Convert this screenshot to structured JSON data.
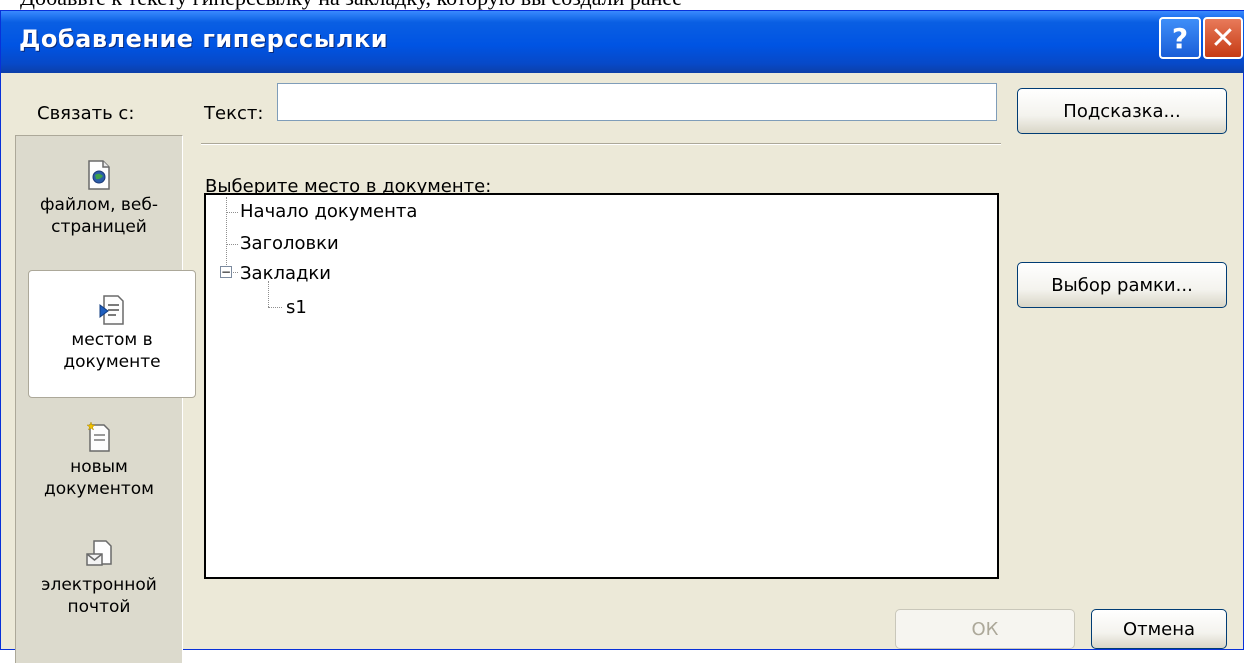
{
  "background_text": "Добавьте к тексту гиперссылку на закладку, которую вы создали ранее",
  "dialog": {
    "title": "Добавление гиперссылки",
    "help_button": "?",
    "close_button": "✕"
  },
  "sidebar": {
    "label": "Связать с:",
    "items": [
      {
        "label": "файлом, веб-\nстраницей",
        "icon": "web-page-icon",
        "selected": false
      },
      {
        "label": "местом в\nдокументе",
        "icon": "document-place-icon",
        "selected": true
      },
      {
        "label": "новым\nдокументом",
        "icon": "new-document-icon",
        "selected": false
      },
      {
        "label": "электронной\nпочтой",
        "icon": "email-icon",
        "selected": false
      }
    ]
  },
  "text_field": {
    "label": "Текст:",
    "value": ""
  },
  "buttons": {
    "hint": "Подсказка...",
    "frame": "Выбор рамки...",
    "ok": "ОК",
    "cancel": "Отмена"
  },
  "place": {
    "label": "Выберите место в документе:",
    "tree": {
      "start": "Начало документа",
      "headings": "Заголовки",
      "bookmarks": "Закладки",
      "bookmark_items": [
        "s1"
      ]
    }
  },
  "colors": {
    "title_bar": "#0054e3",
    "dialog_bg": "#ece9d8",
    "close_button": "#c63b14"
  }
}
